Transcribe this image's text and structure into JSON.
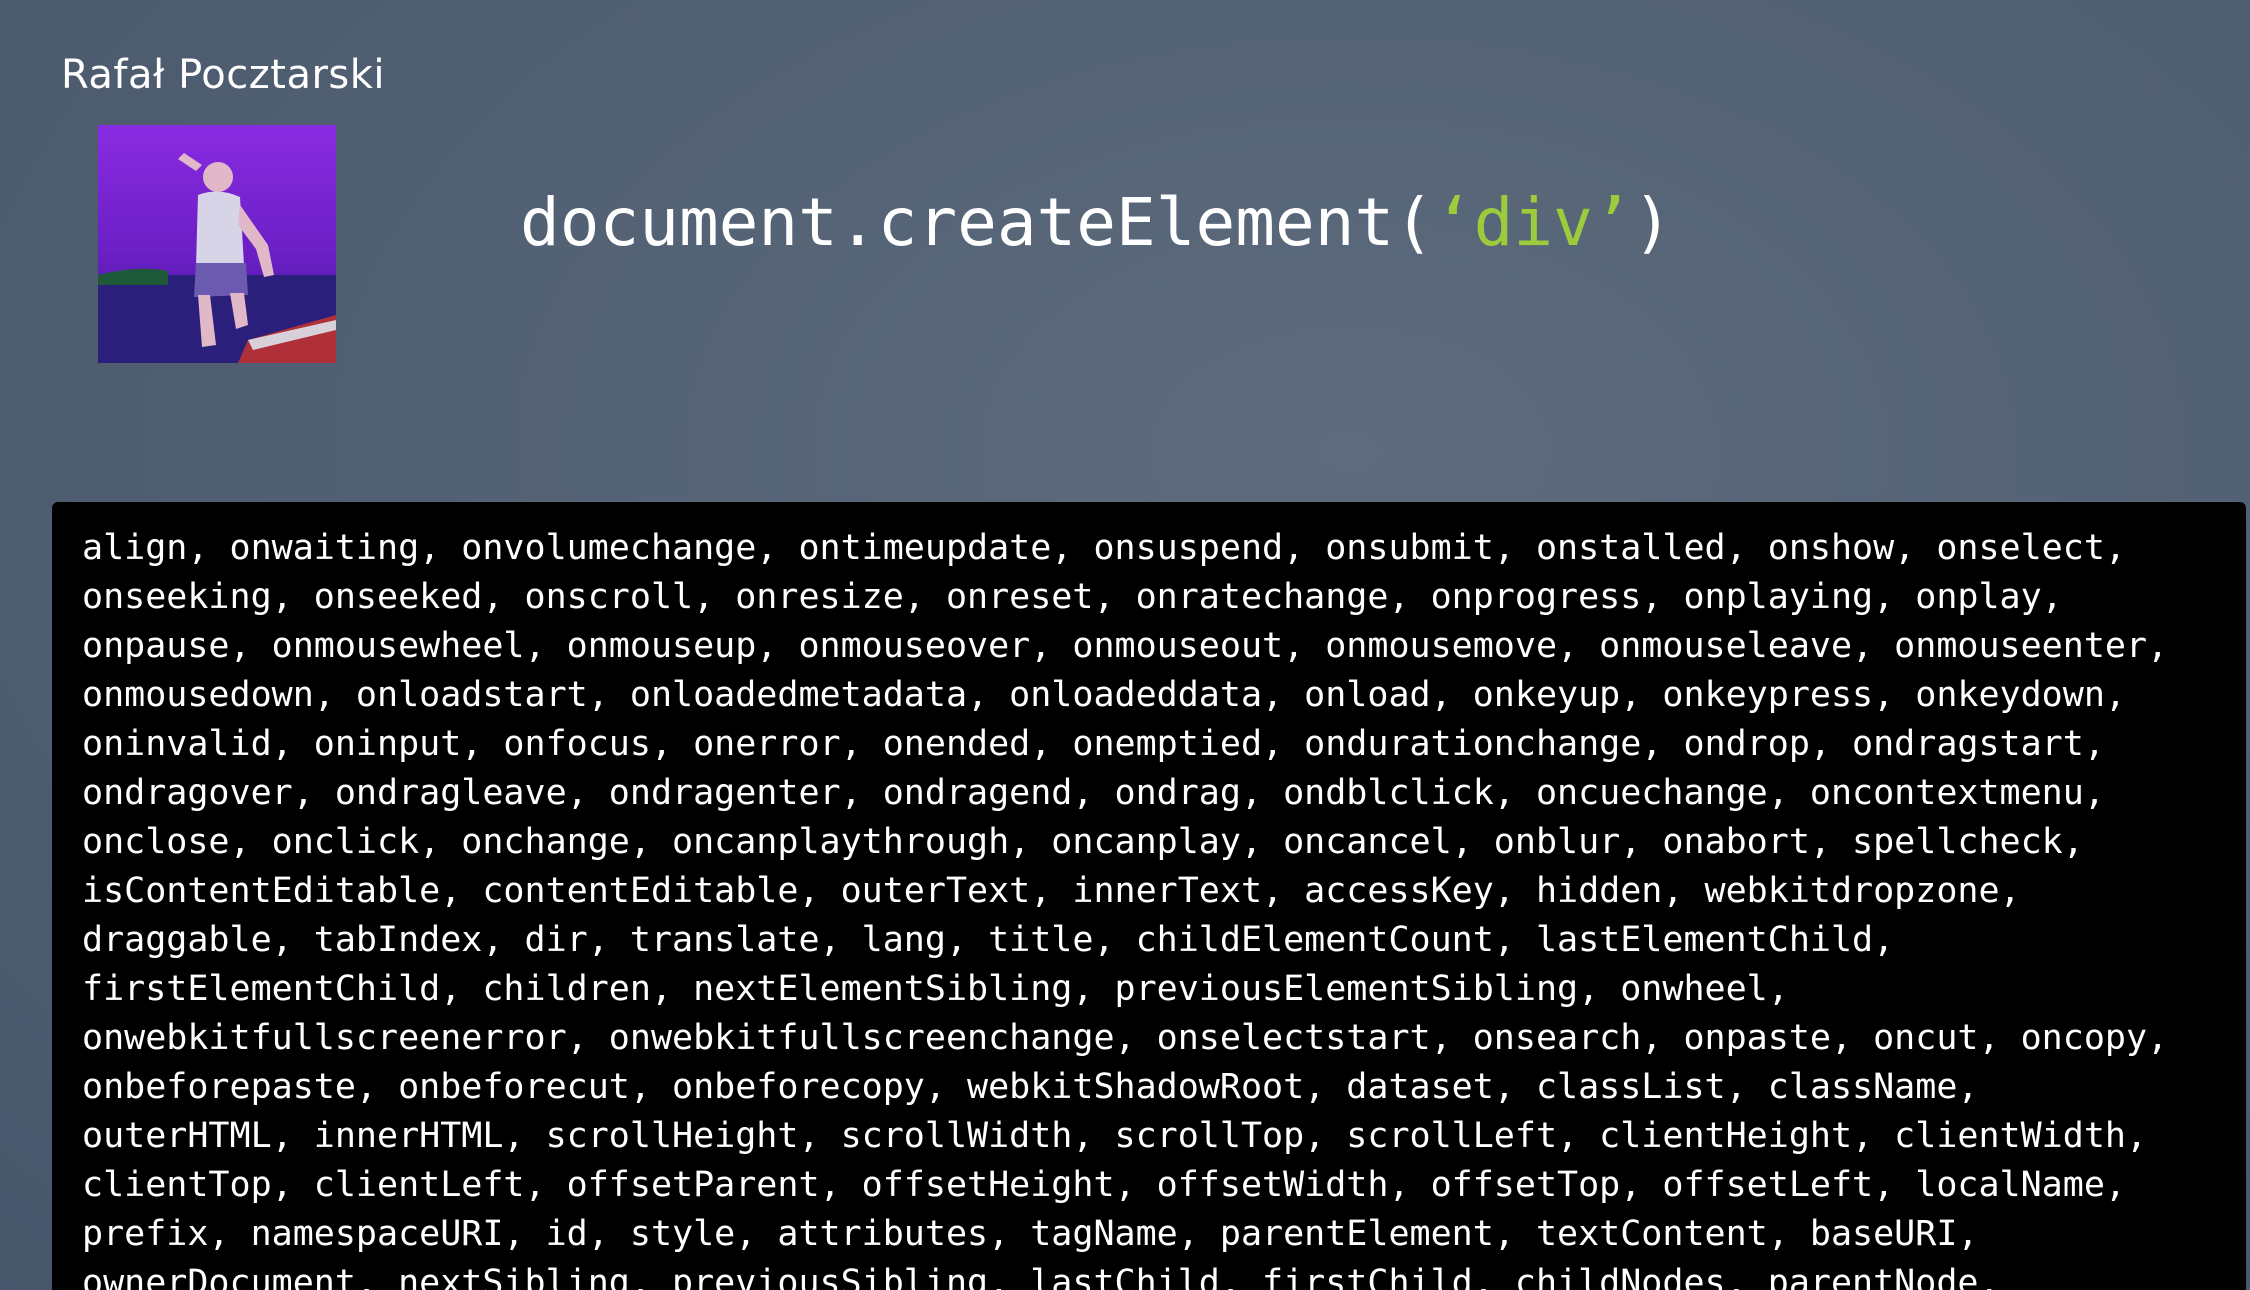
{
  "speaker": {
    "name": "Rafał Pocztarski",
    "photo_icon": "speaker-photo"
  },
  "heading": {
    "prefix": "document.createElement(",
    "argument": "‘div’",
    "suffix": ")",
    "string_color": "#9ccc3c"
  },
  "console": {
    "background": "#000000",
    "lines": [
      "align, onwaiting, onvolumechange, ontimeupdate, onsuspend, onsubmit, onstalled, onshow, onselect,",
      "onseeking, onseeked, onscroll, onresize, onreset, onratechange, onprogress, onplaying, onplay,",
      "onpause, onmousewheel, onmouseup, onmouseover, onmouseout, onmousemove, onmouseleave, onmouseenter,",
      "onmousedown, onloadstart, onloadedmetadata, onloadeddata, onload, onkeyup, onkeypress, onkeydown,",
      "oninvalid, oninput, onfocus, onerror, onended, onemptied, ondurationchange, ondrop, ondragstart,",
      "ondragover, ondragleave, ondragenter, ondragend, ondrag, ondblclick, oncuechange, oncontextmenu,",
      "onclose, onclick, onchange, oncanplaythrough, oncanplay, oncancel, onblur, onabort, spellcheck,",
      "isContentEditable, contentEditable, outerText, innerText, accessKey, hidden, webkitdropzone,",
      "draggable, tabIndex, dir, translate, lang, title, childElementCount, lastElementChild,",
      "firstElementChild, children, nextElementSibling, previousElementSibling, onwheel,",
      "onwebkitfullscreenerror, onwebkitfullscreenchange, onselectstart, onsearch, onpaste, oncut, oncopy,",
      "onbeforepaste, onbeforecut, onbeforecopy, webkitShadowRoot, dataset, classList, className,",
      "outerHTML, innerHTML, scrollHeight, scrollWidth, scrollTop, scrollLeft, clientHeight, clientWidth,",
      "clientTop, clientLeft, offsetParent, offsetHeight, offsetWidth, offsetTop, offsetLeft, localName,",
      "prefix, namespaceURI, id, style, attributes, tagName, parentElement, textContent, baseURI,",
      "ownerDocument, nextSibling, previousSibling, lastChild, firstChild, childNodes, parentNode,"
    ]
  }
}
